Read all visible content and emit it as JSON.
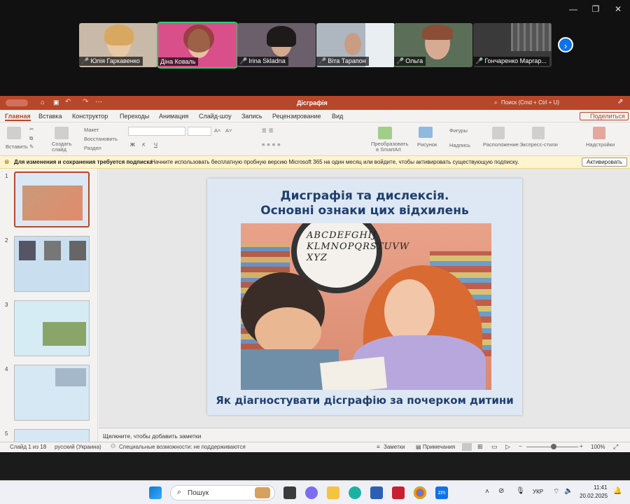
{
  "participants": [
    {
      "name": "Юлія Гаркавенко",
      "bg": "#c9b9a8",
      "muted": true
    },
    {
      "name": "Діна Коваль",
      "bg": "#d94f8a",
      "muted": false
    },
    {
      "name": "Irina Skladna",
      "bg": "#6a5f6b",
      "muted": true
    },
    {
      "name": "Віта Тарапон",
      "bg": "#aeb6c0",
      "muted": true
    },
    {
      "name": "Ольга",
      "bg": "#5a6e58",
      "muted": true
    },
    {
      "name": "Гончаренко Маргар...",
      "bg": "#3a3a3a",
      "muted": true
    }
  ],
  "ppt": {
    "doc_title": "Дісграфія",
    "search_placeholder": "Поиск (Cmd + Ctrl + U)",
    "tabs": [
      "Главная",
      "Вставка",
      "Конструктор",
      "Переходы",
      "Анимация",
      "Слайд-шоу",
      "Запись",
      "Рецензирование",
      "Вид"
    ],
    "share": "Поделиться",
    "ribbon": {
      "paste": "Вставить",
      "new_slide": "Создать слайд",
      "layout": "Макет",
      "reset": "Восстановить",
      "section": "Раздел",
      "bold": "Ж",
      "italic": "К",
      "underline": "Ч",
      "smartart": "Преобразовать в SmartArt",
      "picture": "Рисунок",
      "shapes": "Фигуры",
      "textbox": "Надпись",
      "arrange": "Расположение",
      "quick_styles": "Экспресс-стили",
      "addins": "Надстройки"
    },
    "notice": {
      "bold": "Для изменения и сохранения требуется подписка",
      "text": "Начните использовать бесплатную пробную версию Microsoft 365 на один месяц или войдите, чтобы активировать существующую подписку.",
      "button": "Активировать"
    },
    "thumb_numbers": [
      "1",
      "2",
      "3",
      "4",
      "5"
    ],
    "slide": {
      "title_line1": "Дисграфія та дислексія.",
      "title_line2": "Основні ознаки цих відхилень",
      "bubble_text": "ABCDEFGHIJ KLMNOPQRSTUVW XYZ",
      "caption": "Як діагностувати дісграфію за почерком дитини"
    },
    "notes_placeholder": "Щелкните, чтобы добавить заметки",
    "status": {
      "slide_of": "Слайд 1 из 18",
      "language": "русский (Украина)",
      "accessibility": "Специальные возможности: не поддерживаются",
      "notes": "Заметки",
      "comments": "Примечания",
      "zoom": "100%"
    }
  },
  "taskbar": {
    "search_placeholder": "Пошук",
    "lang": "УКР",
    "time": "11:41",
    "date": "20.02.2025"
  },
  "colors": {
    "ppt_accent": "#b7472a",
    "zoom_blue": "#0e72ed"
  }
}
